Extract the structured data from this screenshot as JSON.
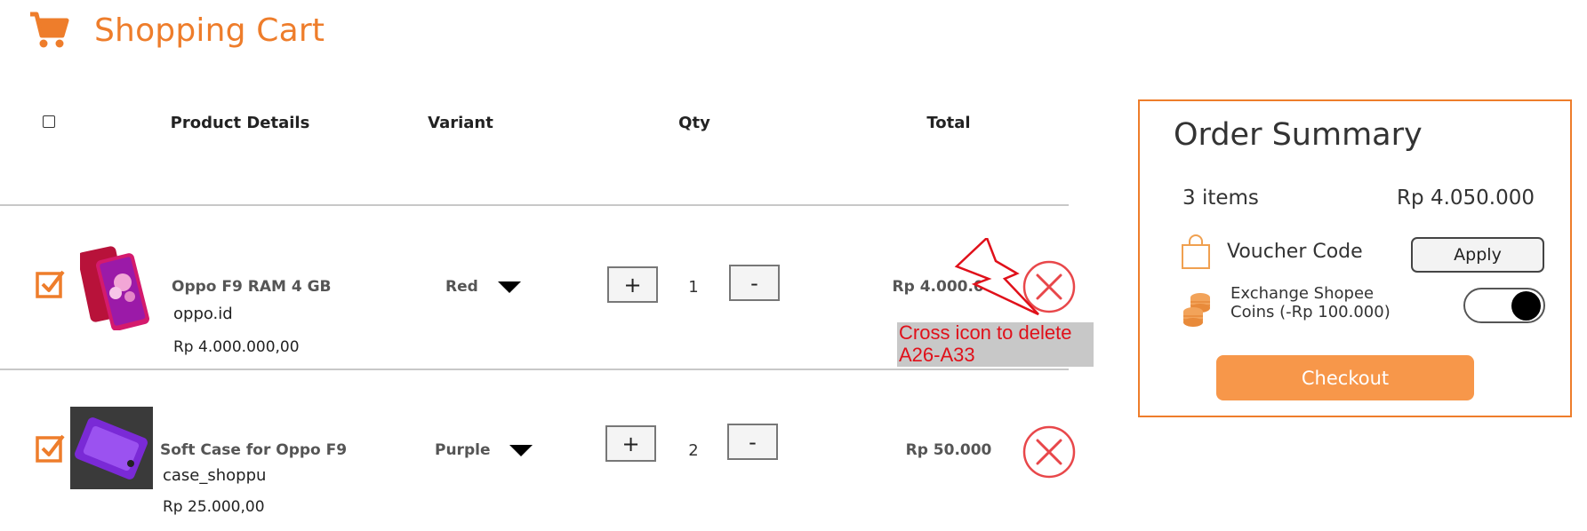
{
  "header": {
    "title": "Shopping Cart",
    "icon": "shopping-cart-icon"
  },
  "table": {
    "columns": [
      "Product Details",
      "Variant",
      "Qty",
      "Total"
    ]
  },
  "items": [
    {
      "name": "Oppo F9 RAM 4 GB",
      "shop": "oppo.id",
      "price": "Rp 4.000.000,00",
      "variant": "Red",
      "qty": "1",
      "total": "Rp 4.000.000",
      "checked": true
    },
    {
      "name": "Soft Case for Oppo F9",
      "shop": "case_shoppu",
      "price": "Rp 25.000,00",
      "variant": "Purple",
      "qty": "2",
      "total": "Rp 50.000",
      "checked": true
    }
  ],
  "qty_controls": {
    "plus": "+",
    "minus": "-"
  },
  "annotation": {
    "line1": "Cross icon to delete",
    "line2": "A26-A33"
  },
  "summary": {
    "title": "Order Summary",
    "items_count": "3 items",
    "items_total": "Rp 4.050.000",
    "voucher_label": "Voucher Code",
    "apply_label": "Apply",
    "coins_label": "Exchange Shopee Coins (-Rp 100.000)",
    "coins_toggle_on": true,
    "checkout_label": "Checkout"
  },
  "colors": {
    "accent": "#ee7d2b",
    "checkout": "#f7974a",
    "delete": "#e8474a",
    "annotation_text": "#e0101a"
  }
}
